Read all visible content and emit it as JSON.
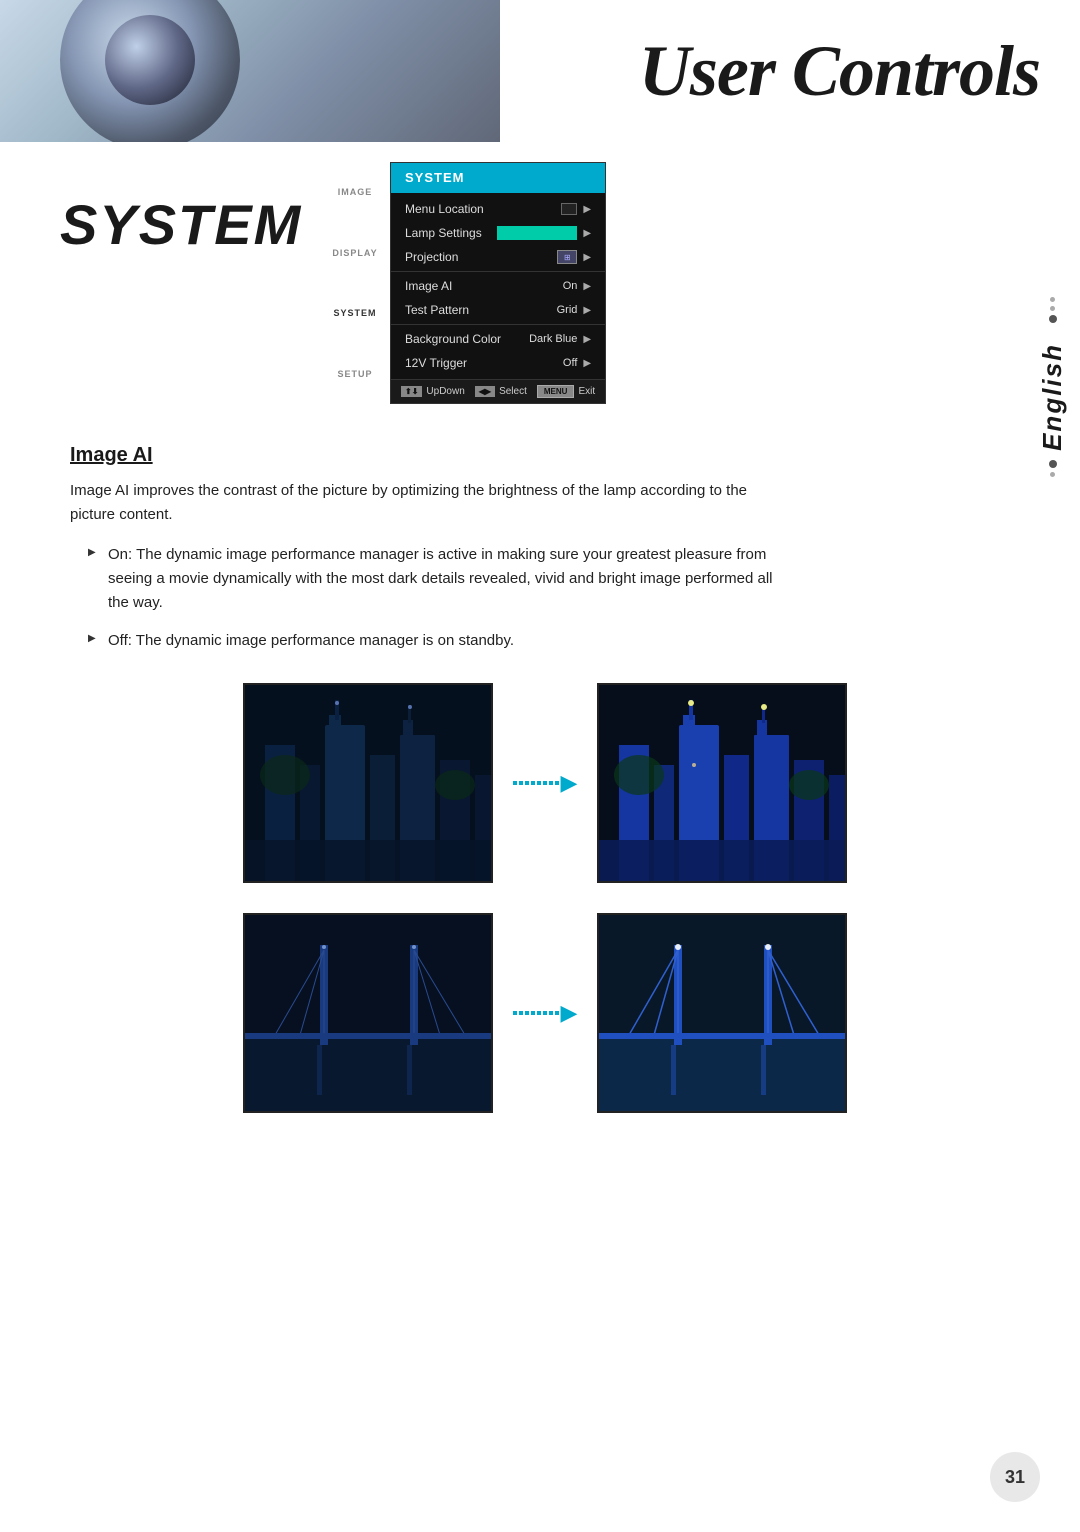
{
  "header": {
    "title": "User Controls"
  },
  "system_title": "SYSTEM",
  "menu": {
    "header": "SYSTEM",
    "items": [
      {
        "label": "Menu Location",
        "value": "",
        "type": "icon"
      },
      {
        "label": "Lamp Settings",
        "value": "",
        "type": "bar"
      },
      {
        "label": "Projection",
        "value": "",
        "type": "projection-icon"
      },
      {
        "label": "Image AI",
        "value": "On",
        "type": "text"
      },
      {
        "label": "Test Pattern",
        "value": "Grid",
        "type": "text"
      },
      {
        "label": "Background Color",
        "value": "Dark Blue",
        "type": "text"
      },
      {
        "label": "12V Trigger",
        "value": "Off",
        "type": "text"
      }
    ],
    "nav_tabs": [
      "IMAGE",
      "DISPLAY",
      "SYSTEM",
      "SETUP"
    ],
    "footer": {
      "updown": "UpDown",
      "select": "Select",
      "menu": "MENU",
      "exit": "Exit"
    }
  },
  "image_ai": {
    "title": "Image AI",
    "description": "Image AI improves the contrast of the picture by optimizing the brightness of the lamp according to the picture content.",
    "bullets": [
      "On: The dynamic image performance manager is active in making sure your greatest pleasure from seeing a movie dynamically with the most dark details revealed, vivid and bright image performed all the way.",
      "Off: The dynamic image performance manager is on standby."
    ]
  },
  "sidebar": {
    "label": "English"
  },
  "page_number": "31"
}
